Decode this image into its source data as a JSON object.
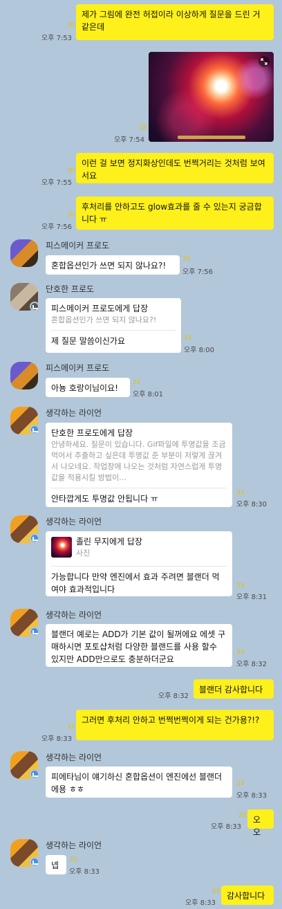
{
  "messages": {
    "m1": {
      "text": "제가 그림에 완전 허접이라 이상하게 질문을 드린 거 같은데",
      "unread": "30",
      "time": "오후 7:53"
    },
    "m2": {
      "unread": "30",
      "time": "오후 7:54"
    },
    "m3": {
      "text": "이런 걸 보면 정지화상인데도 번쩍거리는 것처럼 보여서요",
      "unread": "30",
      "time": "오후 7:55"
    },
    "m4": {
      "text": "후처리를 안하고도 glow효과를 줄 수 있는지 궁금합니다 ㅠ",
      "unread": "30",
      "time": "오후 7:56"
    },
    "m5": {
      "name": "피스메이커 프로도",
      "text": "혼합옵션인가 쓰면 되지 않나요?!",
      "unread": "30",
      "time": "오후 7:56"
    },
    "m6": {
      "name": "단호한 프로도",
      "reply_title": "피스메이커 프로도에게 답장",
      "reply_quote": "혼합옵션인가 쓰면 되지 않나요?!",
      "text": "제 질문 말씀이신가요",
      "unread": "31",
      "time": "오후 8:00"
    },
    "m7": {
      "name": "피스메이커 프로도",
      "text": "아뇽 호랑이님이요!",
      "unread": "31",
      "time": "오후 8:01"
    },
    "m8": {
      "name": "생각하는 라이언",
      "reply_title": "단호한 프로도에게 답장",
      "reply_quote": "안녕하세요. 질문이 있습니다. Gif파일에 투명값을 조금 먹어서 추출하고 싶은데 투명값 준 부분이 저렇게 끊겨서 나오네요. 작업창에 나오는 것처럼 자연스럽게 투명값을 적용시킬 방법이...",
      "text": "안타깝게도 투명값 안됩니다 ㅠ",
      "unread": "33",
      "time": "오후 8:30"
    },
    "m9": {
      "name": "생각하는 라이언",
      "reply_title": "졸린 무지에게 답장",
      "reply_quote": "사진",
      "text": "가능합니다 만약 엔진에서 효과 주려면 블랜더 먹여야 효과적입니다",
      "unread": "33",
      "time": "오후 8:31"
    },
    "m10": {
      "name": "생각하는 라이언",
      "text": "블랜더 예로는 ADD가 기본 값이 될꺼에요 에셋 구매하시면 포토샵처럼 다양한 블랜드를 사용 할수 있지만 ADD만으로도 충분하더군요",
      "unread": "33",
      "time": "오후 8:32"
    },
    "m11": {
      "text": "블랜더 감사합니다",
      "time": "오후 8:32"
    },
    "m12": {
      "text": "그러면 후처리 안하고 번쩍번쩍이게 되는 건가용?!?",
      "unread": "33",
      "time": "오후 8:33"
    },
    "m13": {
      "name": "생각하는 라이언",
      "text": "피에타님이 얘기하신 혼합옵션이 엔진에선 블랜더에용 ㅎㅎ",
      "unread": "33",
      "time": "오후 8:33"
    },
    "m14": {
      "text": "오오",
      "unread": "33",
      "time": "오후 8:33"
    },
    "m15": {
      "name": "생각하는 라이언",
      "text": "넵",
      "unread": "33",
      "time": "오후 8:33"
    },
    "m16": {
      "text": "감사합니다",
      "unread": "33",
      "time": "오후 8:33"
    }
  },
  "colors": {
    "background": "#b2c7d9",
    "my_bubble": "#fef01b",
    "their_bubble": "#ffffff",
    "unread": "#e6c000"
  },
  "icons": {
    "photo_expand": "expand-icon",
    "crown": "crown-badge-icon",
    "profile_mode": "profile-mode-icon"
  }
}
